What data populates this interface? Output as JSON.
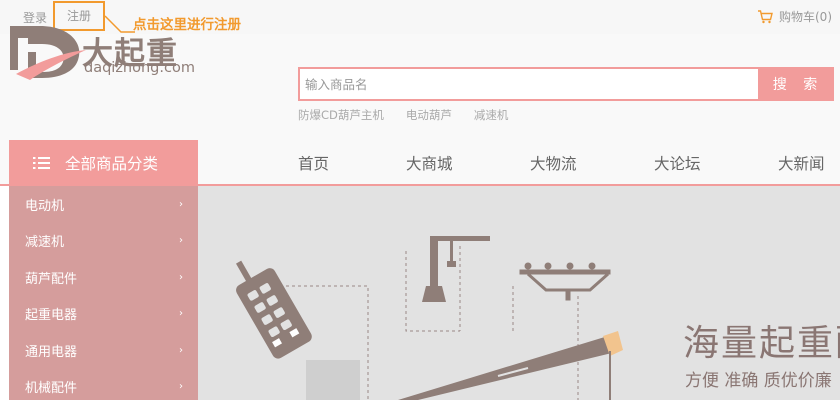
{
  "topbar": {
    "login_label": "登录",
    "register_label": "注册",
    "callout": "点击这里进行注册",
    "cart_label": "购物车(0)",
    "cart_icon": "cart-icon"
  },
  "header": {
    "logo_cn": "大起重",
    "logo_en": "daqizhong.com",
    "search_placeholder": "输入商品名",
    "search_button": "搜 索",
    "hot_words": [
      "防爆CD葫芦主机",
      "电动葫芦",
      "减速机"
    ]
  },
  "nav": {
    "category_label": "全部商品分类",
    "items": [
      "首页",
      "大商城",
      "大物流",
      "大论坛",
      "大新闻"
    ]
  },
  "sidebar": {
    "items": [
      "电动机",
      "减速机",
      "葫芦配件",
      "起重电器",
      "通用电器",
      "机械配件"
    ]
  },
  "banner": {
    "title": "海量起重配",
    "subtitle": "方便 准确 质优价廉"
  },
  "colors": {
    "accent": "#f29c9b",
    "sidebar": "#d59d9c",
    "callout": "#f29a2e",
    "brand": "#8f7e78",
    "banner_bg": "#e2e2e2"
  }
}
